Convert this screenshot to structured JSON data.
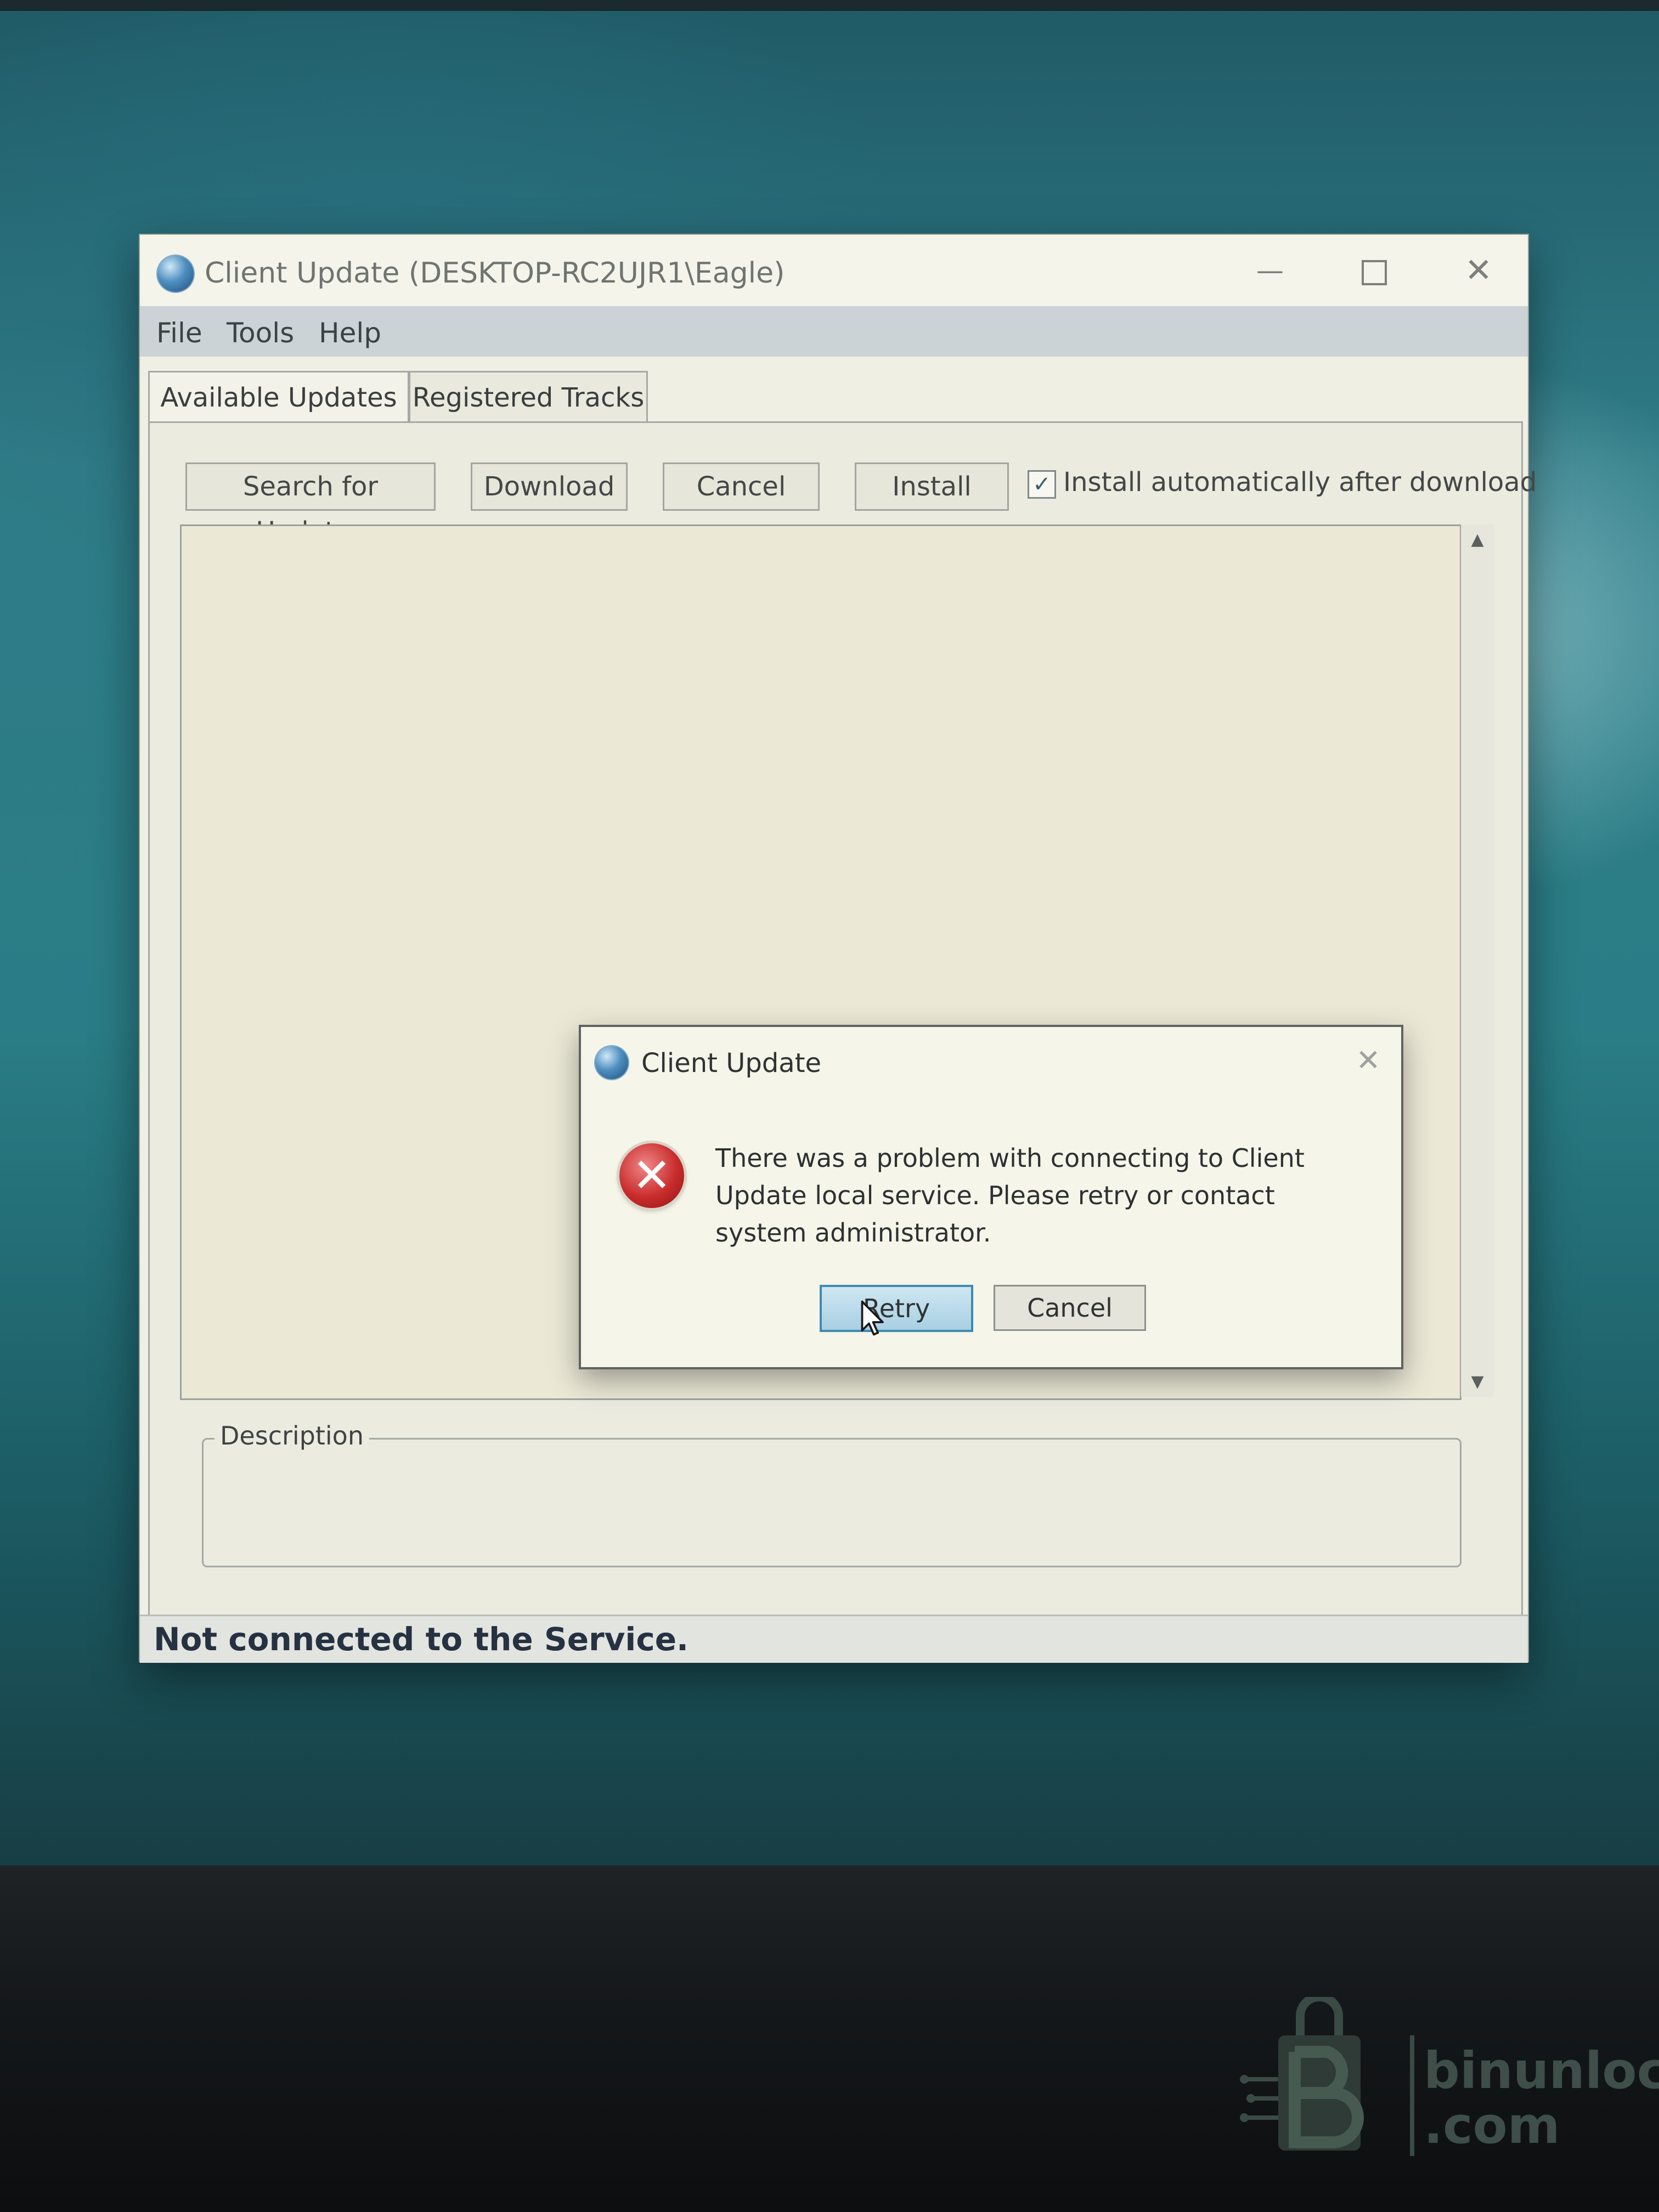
{
  "window": {
    "title": "Client Update (DESKTOP-RC2UJR1\\Eagle)",
    "controls": {
      "minimize": "—",
      "close": "✕"
    }
  },
  "menu": [
    "File",
    "Tools",
    "Help"
  ],
  "tabs": [
    {
      "label": "Available Updates",
      "selected": true
    },
    {
      "label": "Registered Tracks",
      "selected": false
    }
  ],
  "toolbar": {
    "search_label": "Search for Updates",
    "download_label": "Download",
    "cancel_label": "Cancel",
    "install_label": "Install",
    "auto_install_label": "Install automatically after download",
    "auto_install_checked": true,
    "check_mark": "✓"
  },
  "scroll": {
    "up": "▲",
    "down": "▼"
  },
  "description": {
    "label": "Description"
  },
  "status": {
    "text": "Not connected to the Service."
  },
  "dialog": {
    "title": "Client Update",
    "close": "✕",
    "error_icon": "✕",
    "message": "There was a problem with connecting to Client Update local service. Please retry or contact system administrator.",
    "retry_label": "Retry",
    "cancel_label": "Cancel"
  },
  "watermark": {
    "line1": "binunlock",
    "line2": ".com"
  },
  "colors": {
    "window_bg": "#f0efe4",
    "menubar_bg": "#ccd3d6",
    "status_text": "#263142",
    "retry_border": "#3f8ab1",
    "error_red": "#c92c2c"
  },
  "icons": [
    "app-globe-icon",
    "error-icon",
    "mouse-cursor-icon",
    "checkbox-check-icon"
  ]
}
